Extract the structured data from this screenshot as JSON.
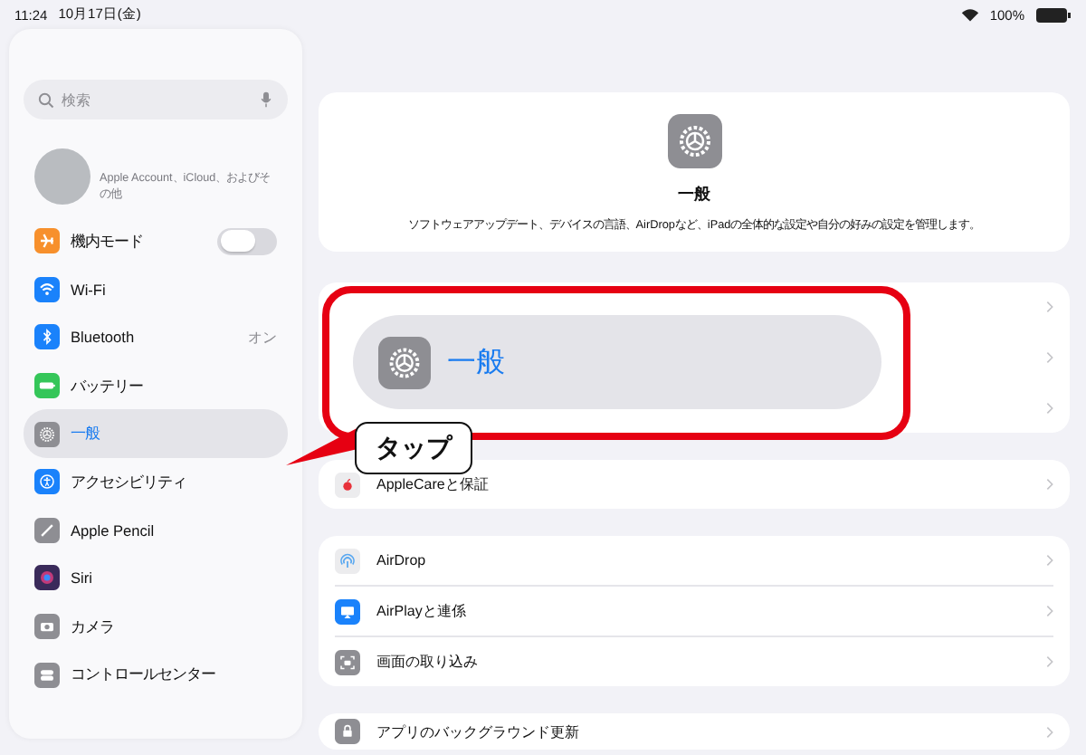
{
  "status_bar": {
    "time": "11:24",
    "date": "10月17日(金)",
    "battery": "100%"
  },
  "sidebar": {
    "search": {
      "placeholder": "検索"
    },
    "account": {
      "caption": "Apple Account、iCloud、およびその他"
    },
    "items": [
      {
        "label": "機内モード",
        "kind": "toggle",
        "color": "#f7902c",
        "on": false,
        "selected": false
      },
      {
        "label": "Wi-Fi",
        "kind": "plain",
        "color": "#1a82fb",
        "selected": false
      },
      {
        "label": "Bluetooth",
        "kind": "value",
        "color": "#1a82fb",
        "value": "オン",
        "selected": false
      },
      {
        "label": "バッテリー",
        "kind": "plain",
        "color": "#35c659",
        "selected": false
      },
      {
        "label": "一般",
        "kind": "plain",
        "color": "#8e8e93",
        "selected": true
      },
      {
        "label": "アクセシビリティ",
        "kind": "plain",
        "color": "#1a82fb",
        "selected": false
      },
      {
        "label": "Apple Pencil",
        "kind": "plain",
        "color": "#8e8e93",
        "selected": false
      },
      {
        "label": "Siri",
        "kind": "plain",
        "color": "#3a2a5a",
        "selected": false
      },
      {
        "label": "カメラ",
        "kind": "plain",
        "color": "#8e8e93",
        "selected": false
      },
      {
        "label": "コントロールセンター",
        "kind": "plain",
        "color": "#8e8e93",
        "selected": false
      }
    ]
  },
  "main": {
    "header": {
      "title": "一般",
      "description": "ソフトウェアアップデート、デバイスの言語、AirDropなど、iPadの全体的な設定や自分の好みの設定を管理します。"
    },
    "groups": [
      {
        "rows": [
          {
            "label": "AppleCareと保証",
            "color": "#ececee"
          }
        ]
      },
      {
        "rows": [
          {
            "label": "AirDrop",
            "color": "#ececee"
          },
          {
            "label": "AirPlayと連係",
            "color": "#1a82fb"
          },
          {
            "label": "画面の取り込み",
            "color": "#8e8e93"
          }
        ]
      },
      {
        "rows": [
          {
            "label": "アプリのバックグラウンド更新",
            "color": "#8e8e93"
          }
        ]
      }
    ]
  },
  "annotation": {
    "magnified_label": "一般",
    "callout": "タップ"
  }
}
